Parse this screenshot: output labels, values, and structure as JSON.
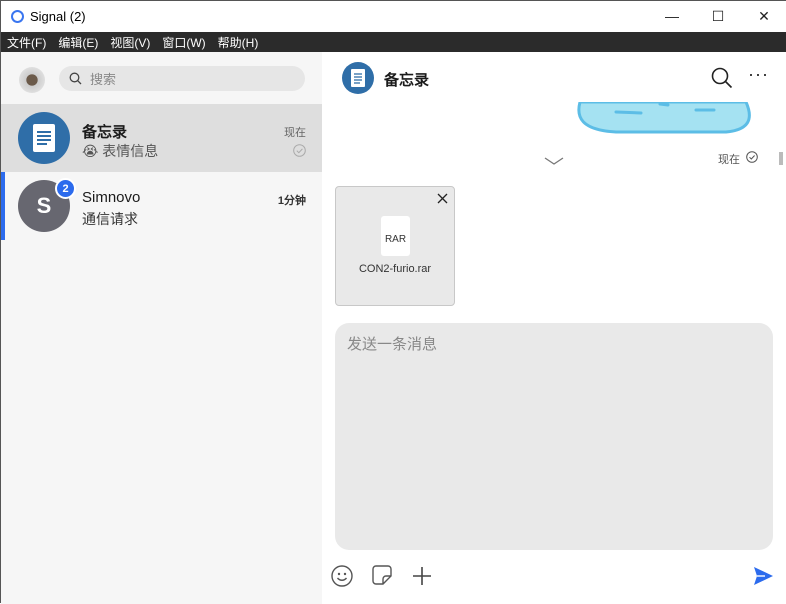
{
  "window": {
    "title": "Signal (2)",
    "controls": [
      "—",
      "☐",
      "✕"
    ]
  },
  "menu": [
    "文件(F)",
    "编辑(E)",
    "视图(V)",
    "窗口(W)",
    "帮助(H)"
  ],
  "search": {
    "placeholder": "搜索"
  },
  "conversations": [
    {
      "name": "备忘录",
      "preview": "😭 表情信息",
      "time": "现在"
    },
    {
      "name": "Simnovo",
      "initial": "S",
      "preview": "通信请求",
      "time": "1分钟",
      "unread": "2"
    }
  ],
  "chat": {
    "title": "备忘录",
    "status_time": "现在",
    "attachment": {
      "type": "RAR",
      "name": "CON2-furio.rar"
    },
    "composer_placeholder": "发送一条消息"
  },
  "colors": {
    "accent": "#2c6bed",
    "note_avatar": "#2f6ea8",
    "menubar": "#2b2b2b"
  }
}
